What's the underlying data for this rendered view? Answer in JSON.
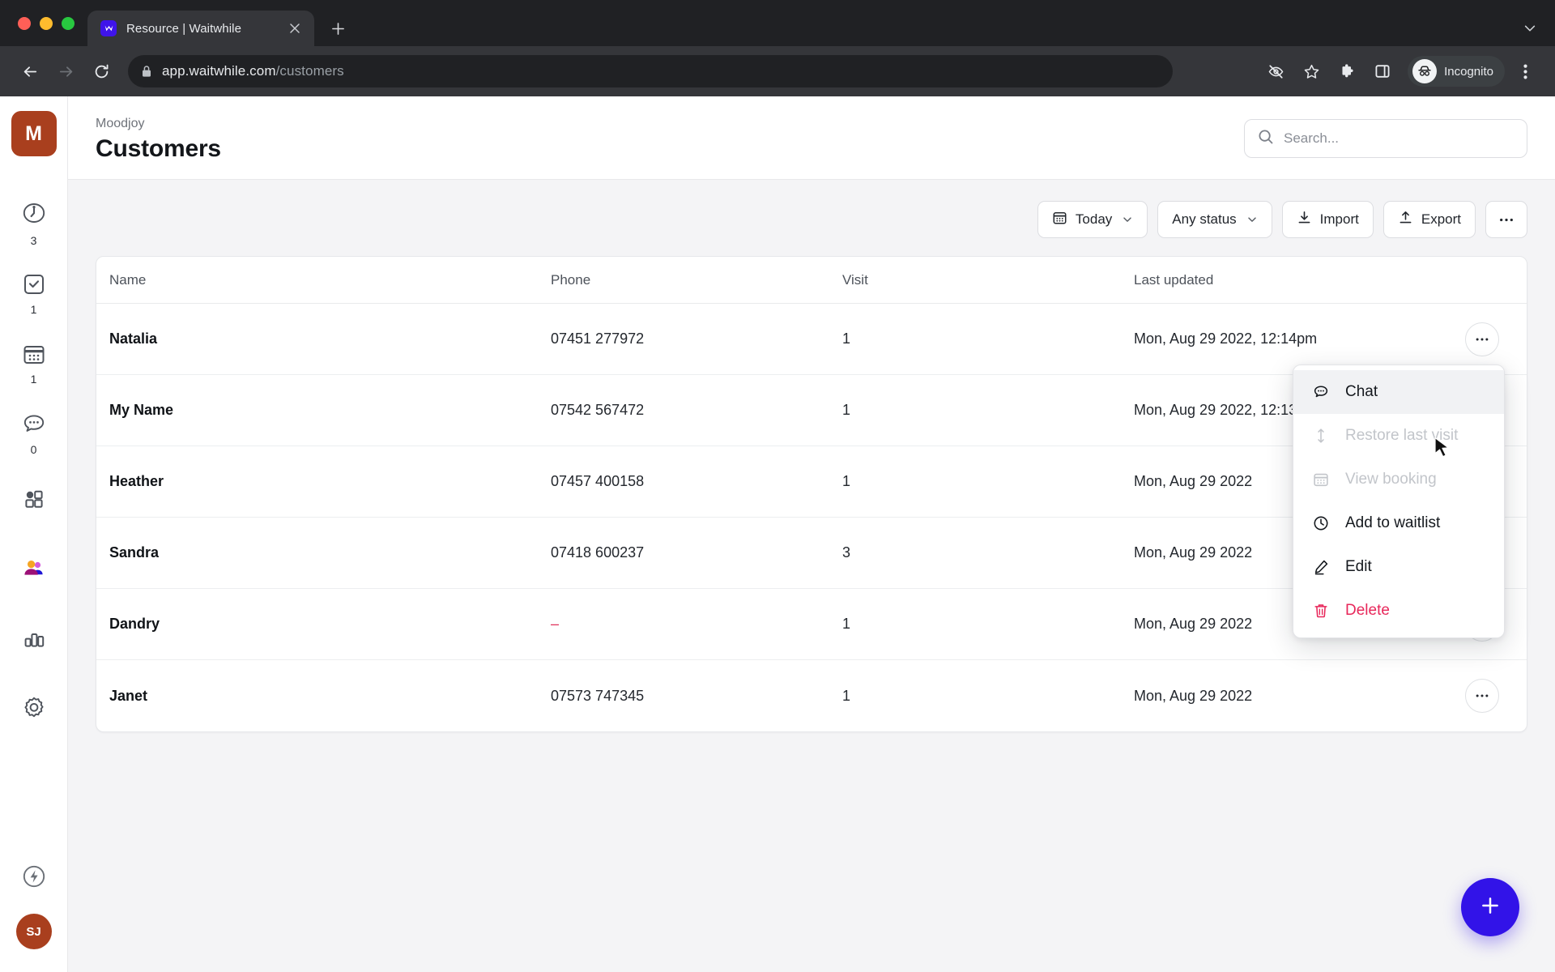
{
  "browser": {
    "tab": {
      "title": "Resource | Waitwhile",
      "favicon": "waitwhile-icon",
      "close": "×"
    },
    "new_tab_label": "+",
    "url_host": "app.waitwhile.com",
    "url_path": "/customers",
    "profile_label": "Incognito",
    "icons": [
      "back-icon",
      "forward-icon",
      "reload-icon",
      "lock-icon",
      "eye-off-icon",
      "star-icon",
      "extensions-icon",
      "side-panel-icon",
      "incognito-icon",
      "browser-menu-icon"
    ]
  },
  "sidebar": {
    "brand_initial": "M",
    "items": [
      {
        "name": "waitlist",
        "icon": "clock-person-icon",
        "count": "3"
      },
      {
        "name": "checkin",
        "icon": "check-box-icon",
        "count": "1"
      },
      {
        "name": "bookings",
        "icon": "calendar-icon",
        "count": "1"
      },
      {
        "name": "messages",
        "icon": "chat-bubble-icon",
        "count": "0"
      },
      {
        "name": "apps",
        "icon": "grid-apps-icon",
        "count": ""
      },
      {
        "name": "customers",
        "icon": "people-icon",
        "count": "",
        "active": true
      },
      {
        "name": "analytics",
        "icon": "bar-chart-icon",
        "count": ""
      },
      {
        "name": "settings",
        "icon": "gear-icon",
        "count": ""
      }
    ],
    "bottom": {
      "power_icon": "lightning-bolt-icon",
      "avatar_initials": "SJ"
    }
  },
  "header": {
    "breadcrumb": "Moodjoy",
    "title": "Customers",
    "search_placeholder": "Search...",
    "search_value": ""
  },
  "toolbar": {
    "date_filter": "Today",
    "status_filter": "Any status",
    "import_label": "Import",
    "export_label": "Export",
    "more_label": "•••"
  },
  "table": {
    "columns": [
      "Name",
      "Phone",
      "Visit",
      "Last updated"
    ],
    "rows": [
      {
        "name": "Natalia",
        "phone": "07451 277972",
        "visit": "1",
        "updated": "Mon, Aug 29 2022, 12:14pm"
      },
      {
        "name": "My Name",
        "phone": "07542 567472",
        "visit": "1",
        "updated": "Mon, Aug 29 2022, 12:13pm"
      },
      {
        "name": "Heather",
        "phone": "07457 400158",
        "visit": "1",
        "updated": "Mon, Aug 29 2022"
      },
      {
        "name": "Sandra",
        "phone": "07418 600237",
        "visit": "3",
        "updated": "Mon, Aug 29 2022"
      },
      {
        "name": "Dandry",
        "phone": "–",
        "visit": "1",
        "updated": "Mon, Aug 29 2022"
      },
      {
        "name": "Janet",
        "phone": "07573 747345",
        "visit": "1",
        "updated": "Mon, Aug 29 2022"
      }
    ]
  },
  "context_menu": {
    "items": [
      {
        "label": "Chat",
        "icon": "chat-bubble-icon",
        "state": "hovered"
      },
      {
        "label": "Restore last visit",
        "icon": "restore-arrows-icon",
        "state": "disabled"
      },
      {
        "label": "View booking",
        "icon": "calendar-icon",
        "state": "disabled"
      },
      {
        "label": "Add to waitlist",
        "icon": "clock-icon",
        "state": "normal"
      },
      {
        "label": "Edit",
        "icon": "pencil-icon",
        "state": "normal"
      },
      {
        "label": "Delete",
        "icon": "trash-icon",
        "state": "danger"
      }
    ]
  },
  "fab": {
    "label": "+",
    "icon": "plus-icon"
  },
  "colors": {
    "brand_brown": "#a93f1e",
    "accent_blue": "#3213e8",
    "danger_pink": "#e8275a",
    "chrome_dark": "#202124",
    "app_bg": "#f4f4f6"
  }
}
